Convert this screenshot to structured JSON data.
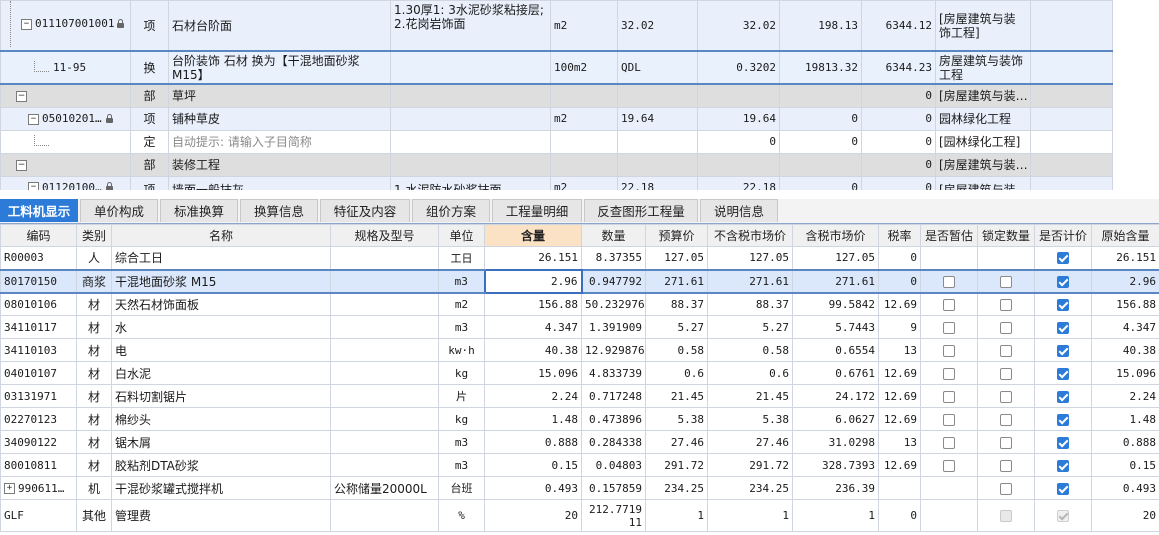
{
  "top_rows": [
    {
      "code": "011107001001",
      "type": "项",
      "name": "石材台阶面",
      "feature": "1.30厚1: 3水泥砂浆粘接层;\n2.花岗岩饰面",
      "unit": "m2",
      "expr": "32.02",
      "qty": "32.02",
      "price": "198.13",
      "total": "6344.12",
      "spec": "[房屋建筑与装饰工程]"
    },
    {
      "code": "11-95",
      "type": "换",
      "name": "台阶装饰 石材  换为【干混地面砂浆 M15】",
      "feature": "",
      "unit": "100m2",
      "expr": "QDL",
      "qty": "0.3202",
      "price": "19813.32",
      "total": "6344.23",
      "spec": "房屋建筑与装饰工程"
    },
    {
      "code": "",
      "type": "部",
      "name": "草坪",
      "feature": "",
      "unit": "",
      "expr": "",
      "qty": "",
      "price": "",
      "total": "0",
      "spec": "[房屋建筑与装…"
    },
    {
      "code": "05010201…",
      "type": "项",
      "name": "铺种草皮",
      "feature": "",
      "unit": "m2",
      "expr": "19.64",
      "qty": "19.64",
      "price": "0",
      "total": "0",
      "spec": "园林绿化工程"
    },
    {
      "code": "",
      "type": "定",
      "name": "自动提示: 请输入子目简称",
      "feature": "",
      "unit": "",
      "expr": "",
      "qty": "0",
      "price": "0",
      "total": "0",
      "spec": "[园林绿化工程]"
    },
    {
      "code": "",
      "type": "部",
      "name": "装修工程",
      "feature": "",
      "unit": "",
      "expr": "",
      "qty": "",
      "price": "",
      "total": "0",
      "spec": "[房屋建筑与装…"
    },
    {
      "code": "01120100…",
      "type": "项",
      "name": "墙面一般抹灰",
      "feature": "1.水泥防水砂浆抹面",
      "unit": "m2",
      "expr": "22.18",
      "qty": "22.18",
      "price": "0",
      "total": "0",
      "spec": "[房屋建筑与装…"
    }
  ],
  "tabs": [
    "工料机显示",
    "单价构成",
    "标准换算",
    "换算信息",
    "特征及内容",
    "组价方案",
    "工程量明细",
    "反查图形工程量",
    "说明信息"
  ],
  "headers": [
    "编码",
    "类别",
    "名称",
    "规格及型号",
    "单位",
    "含量",
    "数量",
    "预算价",
    "不含税市场价",
    "含税市场价",
    "税率",
    "是否暂估",
    "锁定数量",
    "是否计价",
    "原始含量"
  ],
  "rows": [
    {
      "code": "R00003",
      "cat": "人",
      "name": "综合工日",
      "spec": "",
      "unit": "工日",
      "content": "26.151",
      "qty": "8.37355",
      "budget": "127.05",
      "mkt_ex": "127.05",
      "mkt_in": "127.05",
      "tax": "0",
      "zan": "none",
      "lock": "none",
      "ji": "on",
      "orig": "26.151"
    },
    {
      "code": "80170150",
      "cat": "商浆",
      "name": "干混地面砂浆 M15",
      "spec": "",
      "unit": "m3",
      "content": "2.96",
      "qty": "0.947792",
      "budget": "271.61",
      "mkt_ex": "271.61",
      "mkt_in": "271.61",
      "tax": "0",
      "zan": "off",
      "lock": "off",
      "ji": "on",
      "orig": "2.96"
    },
    {
      "code": "08010106",
      "cat": "材",
      "name": "天然石材饰面板",
      "spec": "",
      "unit": "m2",
      "content": "156.88",
      "qty": "50.232976",
      "budget": "88.37",
      "mkt_ex": "88.37",
      "mkt_in": "99.5842",
      "tax": "12.69",
      "zan": "off",
      "lock": "off",
      "ji": "on",
      "orig": "156.88"
    },
    {
      "code": "34110117",
      "cat": "材",
      "name": "水",
      "spec": "",
      "unit": "m3",
      "content": "4.347",
      "qty": "1.391909",
      "budget": "5.27",
      "mkt_ex": "5.27",
      "mkt_in": "5.7443",
      "tax": "9",
      "zan": "off",
      "lock": "off",
      "ji": "on",
      "orig": "4.347"
    },
    {
      "code": "34110103",
      "cat": "材",
      "name": "电",
      "spec": "",
      "unit": "kw·h",
      "content": "40.38",
      "qty": "12.929876",
      "budget": "0.58",
      "mkt_ex": "0.58",
      "mkt_in": "0.6554",
      "tax": "13",
      "zan": "off",
      "lock": "off",
      "ji": "on",
      "orig": "40.38"
    },
    {
      "code": "04010107",
      "cat": "材",
      "name": "白水泥",
      "spec": "",
      "unit": "kg",
      "content": "15.096",
      "qty": "4.833739",
      "budget": "0.6",
      "mkt_ex": "0.6",
      "mkt_in": "0.6761",
      "tax": "12.69",
      "zan": "off",
      "lock": "off",
      "ji": "on",
      "orig": "15.096"
    },
    {
      "code": "03131971",
      "cat": "材",
      "name": "石料切割锯片",
      "spec": "",
      "unit": "片",
      "content": "2.24",
      "qty": "0.717248",
      "budget": "21.45",
      "mkt_ex": "21.45",
      "mkt_in": "24.172",
      "tax": "12.69",
      "zan": "off",
      "lock": "off",
      "ji": "on",
      "orig": "2.24"
    },
    {
      "code": "02270123",
      "cat": "材",
      "name": "棉纱头",
      "spec": "",
      "unit": "kg",
      "content": "1.48",
      "qty": "0.473896",
      "budget": "5.38",
      "mkt_ex": "5.38",
      "mkt_in": "6.0627",
      "tax": "12.69",
      "zan": "off",
      "lock": "off",
      "ji": "on",
      "orig": "1.48"
    },
    {
      "code": "34090122",
      "cat": "材",
      "name": "锯木屑",
      "spec": "",
      "unit": "m3",
      "content": "0.888",
      "qty": "0.284338",
      "budget": "27.46",
      "mkt_ex": "27.46",
      "mkt_in": "31.0298",
      "tax": "13",
      "zan": "off",
      "lock": "off",
      "ji": "on",
      "orig": "0.888"
    },
    {
      "code": "80010811",
      "cat": "材",
      "name": "胶粘剂DTA砂浆",
      "spec": "",
      "unit": "m3",
      "content": "0.15",
      "qty": "0.04803",
      "budget": "291.72",
      "mkt_ex": "291.72",
      "mkt_in": "328.7393",
      "tax": "12.69",
      "zan": "off",
      "lock": "off",
      "ji": "on",
      "orig": "0.15"
    },
    {
      "code": "990611…",
      "cat": "机",
      "name": "干混砂浆罐式搅拌机",
      "spec": "公称储量20000L",
      "unit": "台班",
      "content": "0.493",
      "qty": "0.157859",
      "budget": "234.25",
      "mkt_ex": "234.25",
      "mkt_in": "236.39",
      "tax": "",
      "zan": "none",
      "lock": "off",
      "ji": "on",
      "orig": "0.493"
    },
    {
      "code": "GLF",
      "cat": "其他",
      "name": "管理费",
      "spec": "",
      "unit": "%",
      "content": "20",
      "qty": "212.771911",
      "budget": "1",
      "mkt_ex": "1",
      "mkt_in": "1",
      "tax": "0",
      "zan": "none",
      "lock": "dis",
      "ji": "dison",
      "orig": "20"
    }
  ],
  "colors": {
    "tab_active": "#2d7bd8",
    "header_highlight": "#fbe2c5",
    "selection_border": "#5b86c4",
    "checkbox_on": "#2d7bd8"
  }
}
